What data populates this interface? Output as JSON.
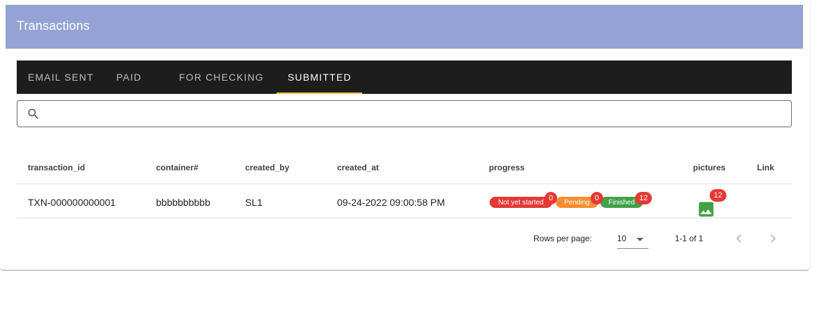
{
  "header": {
    "title": "Transactions",
    "color": "#94a2d6"
  },
  "tabs": [
    {
      "label": "EMAIL SENT",
      "active": false
    },
    {
      "label": "PAID",
      "active": false
    },
    {
      "label": "FOR CHECKING",
      "active": false
    },
    {
      "label": "SUBMITTED",
      "active": true
    }
  ],
  "search": {
    "value": "",
    "placeholder": "",
    "icon": "search-icon"
  },
  "table": {
    "columns": [
      "transaction_id",
      "container#",
      "created_by",
      "created_at",
      "progress",
      "pictures",
      "Link"
    ],
    "rows": [
      {
        "transaction_id": "TXN-000000000001",
        "container": "bbbbbbbbbb",
        "created_by": "SL1",
        "created_at": "09-24-2022 09:00:58 PM",
        "progress": [
          {
            "label": "Not yet started",
            "count": "0",
            "color": "#e53935"
          },
          {
            "label": "Pending",
            "count": "0",
            "color": "#f68d2e"
          },
          {
            "label": "Finished",
            "count": "12",
            "color": "#43a047"
          }
        ],
        "pictures": {
          "icon": "image-icon",
          "count": "12"
        },
        "link": ""
      }
    ]
  },
  "pagination": {
    "rows_per_page_label": "Rows per page:",
    "rows_per_page": "10",
    "range": "1-1 of 1"
  }
}
